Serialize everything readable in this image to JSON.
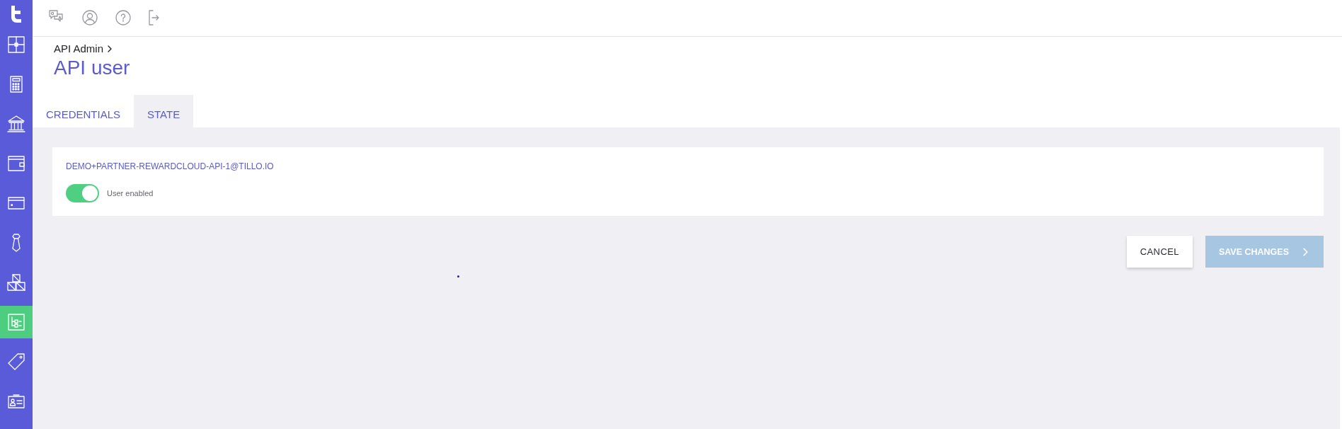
{
  "sidebar": {
    "items": [
      {
        "selected": false
      },
      {
        "selected": false
      },
      {
        "selected": false
      },
      {
        "selected": false
      },
      {
        "selected": false
      },
      {
        "selected": false
      },
      {
        "selected": false
      },
      {
        "selected": true
      },
      {
        "selected": false
      },
      {
        "selected": false
      }
    ]
  },
  "breadcrumb": [
    {
      "label": "API Admin"
    }
  ],
  "title": "API user",
  "tabs": [
    {
      "label": "CREDENTIALS",
      "selected": false
    },
    {
      "label": "STATE",
      "selected": true
    }
  ],
  "card": {
    "heading": "DEMO+PARTNER-REWARDCLOUD-API-1@TILLO.IO",
    "toggle": {
      "label": "User enabled",
      "on": true
    }
  },
  "buttons": [
    {
      "label": "CANCEL",
      "kind": "secondary",
      "disabled": false
    },
    {
      "label": "SAVE CHANGES",
      "kind": "primary",
      "disabled": true
    }
  ]
}
